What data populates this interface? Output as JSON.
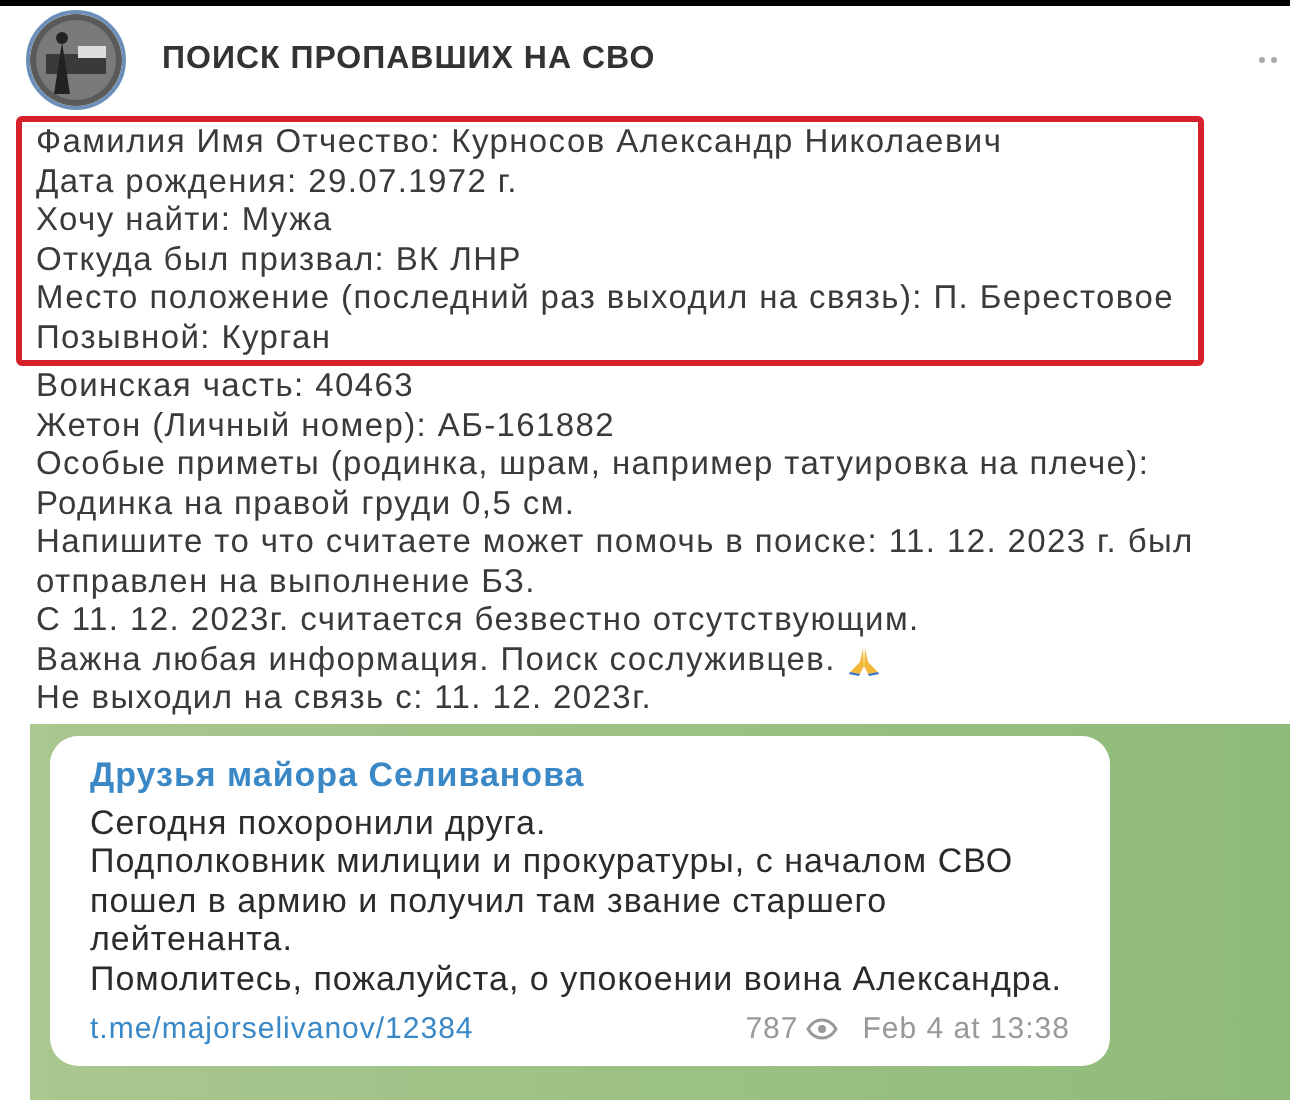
{
  "channel": {
    "title": "ПОИСК ПРОПАВШИХ НА СВО"
  },
  "post": {
    "highlighted_lines": [
      "Фамилия Имя Отчество: Курносов Александр Николаевич",
      "Дата рождения: 29.07.1972 г.",
      "Хочу найти: Мужа",
      "Откуда был призвал: ВК ЛНР",
      "Место положение (последний раз выходил на связь): П. Берестовое",
      "Позывной: Курган"
    ],
    "lines": [
      {
        "text": "Воинская часть: 40463",
        "emoji": false
      },
      {
        "text": "Жетон (Личный номер): АБ-161882",
        "emoji": false
      },
      {
        "text": "Особые приметы (родинка, шрам, например татуировка на плече): Родинка на правой груди 0,5 см.",
        "emoji": false
      },
      {
        "text": "Напишите то что считаете может помочь в поиске: 11. 12. 2023 г. был отправлен на выполнение БЗ.",
        "emoji": false
      },
      {
        "text": "С 11. 12. 2023г. считается безвестно отсутствующим.",
        "emoji": false
      },
      {
        "text": "Важна любая информация. Поиск сослуживцев.",
        "emoji": true
      },
      {
        "text": "Не выходил на связь с: 11. 12. 2023г.",
        "emoji": false
      }
    ]
  },
  "forwarded_message": {
    "source": "Друзья майора Селиванова",
    "paragraphs": [
      "Сегодня похоронили друга.",
      "Подполковник милиции и прокуратуры, с началом СВО пошел в армию и получил там звание старшего лейтенанта.",
      "Помолитесь, пожалуйста, о упокоении воина Александра."
    ],
    "link": "t.me/majorselivanov/12384",
    "views": "787",
    "date": "Feb 4 at 13:38"
  }
}
